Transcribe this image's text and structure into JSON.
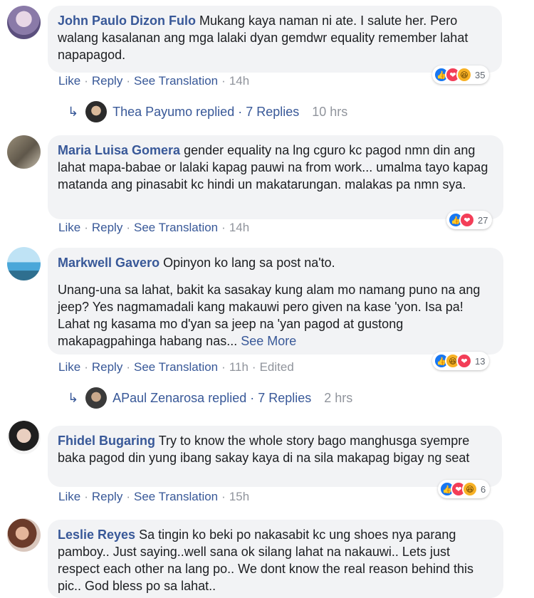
{
  "comments": [
    {
      "author": "John Paulo Dizon Fulo",
      "text": "Mukang kaya naman ni ate. I salute her. Pero walang kasalanan ang mga lalaki dyan gemdwr equality remember lahat napapagod.",
      "like": "Like",
      "reply": "Reply",
      "translate": "See Translation",
      "time": "14h",
      "reaction_count": "35",
      "reaction_icons": [
        "like-icon",
        "love-icon",
        "haha-icon"
      ],
      "replies": {
        "name": "Thea Payumo",
        "replied": "replied",
        "count": "7 Replies",
        "time": "10 hrs"
      }
    },
    {
      "author": "Maria Luisa Gomera",
      "text": "gender equality na lng cguro kc pagod nmn din ang lahat mapa-babae or lalaki kapag pauwi na from work... umalma tayo kapag matanda ang pinasabit kc hindi un makatarungan. malakas pa nmn sya.",
      "like": "Like",
      "reply": "Reply",
      "translate": "See Translation",
      "time": "14h",
      "reaction_count": "27",
      "reaction_icons": [
        "like-icon",
        "love-icon"
      ]
    },
    {
      "author": "Markwell Gavero",
      "text": "Opinyon ko lang sa post na'to.",
      "text2": "Unang-una sa lahat, bakit ka sasakay kung alam mo namang puno na ang jeep? Yes nagmamadali kang makauwi pero given na kase 'yon. Isa pa! Lahat ng kasama mo d'yan sa jeep na 'yan pagod at gustong makapagpahinga habang nas...",
      "see_more": "See More",
      "like": "Like",
      "reply": "Reply",
      "translate": "See Translation",
      "time": "11h",
      "edited": "Edited",
      "reaction_count": "13",
      "reaction_icons": [
        "like-icon",
        "haha-icon",
        "love-icon"
      ],
      "replies": {
        "name": "APaul Zenarosa",
        "replied": "replied",
        "count": "7 Replies",
        "time": "2 hrs"
      }
    },
    {
      "author": "Fhidel Bugaring",
      "text": "Try to know the whole story bago manghusga syempre baka pagod din yung ibang sakay kaya di na sila makapag bigay ng seat",
      "like": "Like",
      "reply": "Reply",
      "translate": "See Translation",
      "time": "15h",
      "reaction_count": "6",
      "reaction_icons": [
        "like-icon",
        "love-icon",
        "haha-icon"
      ]
    },
    {
      "author": "Leslie Reyes",
      "text": "Sa tingin ko beki po nakasabit kc ung shoes nya parang pamboy.. Just saying..well sana ok silang lahat na nakauwi.. Lets just respect each other na lang po.. We dont know the real reason behind this pic.. God bless po sa lahat.."
    }
  ],
  "separator": "·"
}
